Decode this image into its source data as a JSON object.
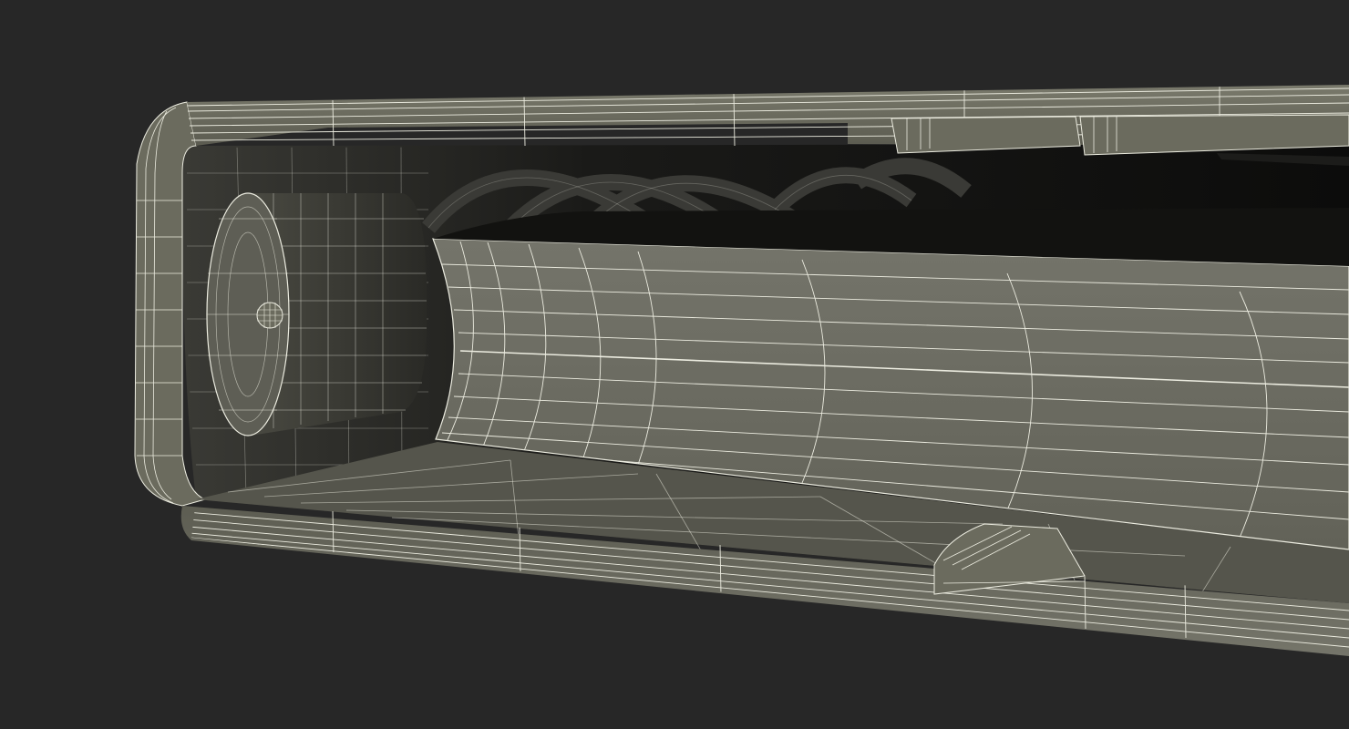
{
  "viewport": {
    "background": "#272727",
    "model": {
      "render_mode": "wireframe-on-shaded",
      "surface_color": "#6b6b5e",
      "wire_color": "#ecece0",
      "interior_color": "#101010"
    }
  }
}
